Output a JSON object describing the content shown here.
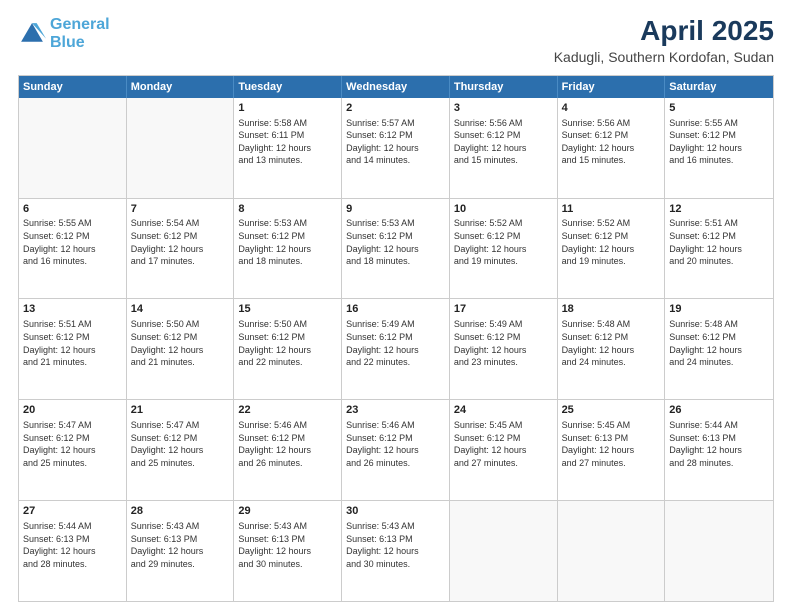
{
  "logo": {
    "line1": "General",
    "line2": "Blue"
  },
  "title": "April 2025",
  "subtitle": "Kadugli, Southern Kordofan, Sudan",
  "weekdays": [
    "Sunday",
    "Monday",
    "Tuesday",
    "Wednesday",
    "Thursday",
    "Friday",
    "Saturday"
  ],
  "rows": [
    [
      {
        "day": "",
        "info": ""
      },
      {
        "day": "",
        "info": ""
      },
      {
        "day": "1",
        "info": "Sunrise: 5:58 AM\nSunset: 6:11 PM\nDaylight: 12 hours\nand 13 minutes."
      },
      {
        "day": "2",
        "info": "Sunrise: 5:57 AM\nSunset: 6:12 PM\nDaylight: 12 hours\nand 14 minutes."
      },
      {
        "day": "3",
        "info": "Sunrise: 5:56 AM\nSunset: 6:12 PM\nDaylight: 12 hours\nand 15 minutes."
      },
      {
        "day": "4",
        "info": "Sunrise: 5:56 AM\nSunset: 6:12 PM\nDaylight: 12 hours\nand 15 minutes."
      },
      {
        "day": "5",
        "info": "Sunrise: 5:55 AM\nSunset: 6:12 PM\nDaylight: 12 hours\nand 16 minutes."
      }
    ],
    [
      {
        "day": "6",
        "info": "Sunrise: 5:55 AM\nSunset: 6:12 PM\nDaylight: 12 hours\nand 16 minutes."
      },
      {
        "day": "7",
        "info": "Sunrise: 5:54 AM\nSunset: 6:12 PM\nDaylight: 12 hours\nand 17 minutes."
      },
      {
        "day": "8",
        "info": "Sunrise: 5:53 AM\nSunset: 6:12 PM\nDaylight: 12 hours\nand 18 minutes."
      },
      {
        "day": "9",
        "info": "Sunrise: 5:53 AM\nSunset: 6:12 PM\nDaylight: 12 hours\nand 18 minutes."
      },
      {
        "day": "10",
        "info": "Sunrise: 5:52 AM\nSunset: 6:12 PM\nDaylight: 12 hours\nand 19 minutes."
      },
      {
        "day": "11",
        "info": "Sunrise: 5:52 AM\nSunset: 6:12 PM\nDaylight: 12 hours\nand 19 minutes."
      },
      {
        "day": "12",
        "info": "Sunrise: 5:51 AM\nSunset: 6:12 PM\nDaylight: 12 hours\nand 20 minutes."
      }
    ],
    [
      {
        "day": "13",
        "info": "Sunrise: 5:51 AM\nSunset: 6:12 PM\nDaylight: 12 hours\nand 21 minutes."
      },
      {
        "day": "14",
        "info": "Sunrise: 5:50 AM\nSunset: 6:12 PM\nDaylight: 12 hours\nand 21 minutes."
      },
      {
        "day": "15",
        "info": "Sunrise: 5:50 AM\nSunset: 6:12 PM\nDaylight: 12 hours\nand 22 minutes."
      },
      {
        "day": "16",
        "info": "Sunrise: 5:49 AM\nSunset: 6:12 PM\nDaylight: 12 hours\nand 22 minutes."
      },
      {
        "day": "17",
        "info": "Sunrise: 5:49 AM\nSunset: 6:12 PM\nDaylight: 12 hours\nand 23 minutes."
      },
      {
        "day": "18",
        "info": "Sunrise: 5:48 AM\nSunset: 6:12 PM\nDaylight: 12 hours\nand 24 minutes."
      },
      {
        "day": "19",
        "info": "Sunrise: 5:48 AM\nSunset: 6:12 PM\nDaylight: 12 hours\nand 24 minutes."
      }
    ],
    [
      {
        "day": "20",
        "info": "Sunrise: 5:47 AM\nSunset: 6:12 PM\nDaylight: 12 hours\nand 25 minutes."
      },
      {
        "day": "21",
        "info": "Sunrise: 5:47 AM\nSunset: 6:12 PM\nDaylight: 12 hours\nand 25 minutes."
      },
      {
        "day": "22",
        "info": "Sunrise: 5:46 AM\nSunset: 6:12 PM\nDaylight: 12 hours\nand 26 minutes."
      },
      {
        "day": "23",
        "info": "Sunrise: 5:46 AM\nSunset: 6:12 PM\nDaylight: 12 hours\nand 26 minutes."
      },
      {
        "day": "24",
        "info": "Sunrise: 5:45 AM\nSunset: 6:12 PM\nDaylight: 12 hours\nand 27 minutes."
      },
      {
        "day": "25",
        "info": "Sunrise: 5:45 AM\nSunset: 6:13 PM\nDaylight: 12 hours\nand 27 minutes."
      },
      {
        "day": "26",
        "info": "Sunrise: 5:44 AM\nSunset: 6:13 PM\nDaylight: 12 hours\nand 28 minutes."
      }
    ],
    [
      {
        "day": "27",
        "info": "Sunrise: 5:44 AM\nSunset: 6:13 PM\nDaylight: 12 hours\nand 28 minutes."
      },
      {
        "day": "28",
        "info": "Sunrise: 5:43 AM\nSunset: 6:13 PM\nDaylight: 12 hours\nand 29 minutes."
      },
      {
        "day": "29",
        "info": "Sunrise: 5:43 AM\nSunset: 6:13 PM\nDaylight: 12 hours\nand 30 minutes."
      },
      {
        "day": "30",
        "info": "Sunrise: 5:43 AM\nSunset: 6:13 PM\nDaylight: 12 hours\nand 30 minutes."
      },
      {
        "day": "",
        "info": ""
      },
      {
        "day": "",
        "info": ""
      },
      {
        "day": "",
        "info": ""
      }
    ]
  ]
}
